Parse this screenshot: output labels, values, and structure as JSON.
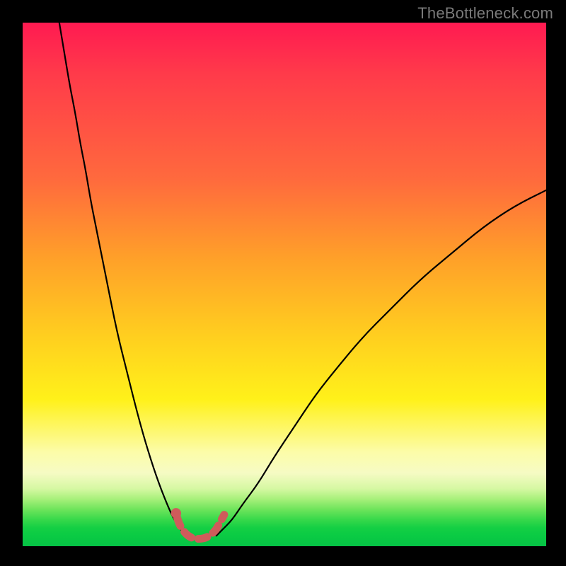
{
  "watermark": "TheBottleneck.com",
  "chart_data": {
    "type": "line",
    "title": "",
    "xlabel": "",
    "ylabel": "",
    "xlim": [
      0,
      100
    ],
    "ylim": [
      0,
      100
    ],
    "grid": false,
    "legend": false,
    "annotations": [
      {
        "text": "TheBottleneck.com",
        "position": "top-right"
      }
    ],
    "background_gradient": {
      "direction": "vertical",
      "stops": [
        {
          "pos": 0.0,
          "color": "#ff1a51"
        },
        {
          "pos": 0.3,
          "color": "#ff6a3d"
        },
        {
          "pos": 0.6,
          "color": "#ffcf1f"
        },
        {
          "pos": 0.82,
          "color": "#fcfca8"
        },
        {
          "pos": 0.93,
          "color": "#6de45b"
        },
        {
          "pos": 1.0,
          "color": "#06c245"
        }
      ]
    },
    "series": [
      {
        "name": "left-branch",
        "stroke": "#000000",
        "x": [
          7,
          8,
          9,
          10,
          11,
          12,
          13,
          14,
          16,
          18,
          20,
          22,
          24,
          26,
          28,
          29,
          30,
          31
        ],
        "y": [
          100,
          94,
          88,
          83,
          77,
          72,
          66,
          61,
          51,
          41,
          33,
          25,
          18,
          12,
          7,
          5,
          3.5,
          2
        ]
      },
      {
        "name": "right-branch",
        "stroke": "#000000",
        "x": [
          37,
          38,
          40,
          42,
          45,
          48,
          52,
          56,
          60,
          65,
          70,
          76,
          82,
          88,
          94,
          100
        ],
        "y": [
          2,
          3,
          5,
          8,
          12,
          17,
          23,
          29,
          34,
          40,
          45,
          51,
          56,
          61,
          65,
          68
        ]
      },
      {
        "name": "valley-marker",
        "stroke": "#cf5b5b",
        "style": "dashed-thick",
        "x": [
          29.5,
          30,
          31,
          32,
          33,
          34,
          35,
          36,
          37,
          37.5,
          38.5
        ],
        "y": [
          5.5,
          4,
          2.5,
          1.7,
          1.4,
          1.4,
          1.6,
          2.2,
          3.2,
          4.2,
          6
        ]
      }
    ],
    "points": [
      {
        "name": "marker-dot",
        "x": 29.3,
        "y": 6.3,
        "color": "#cf5b5b",
        "r": 4
      }
    ]
  }
}
